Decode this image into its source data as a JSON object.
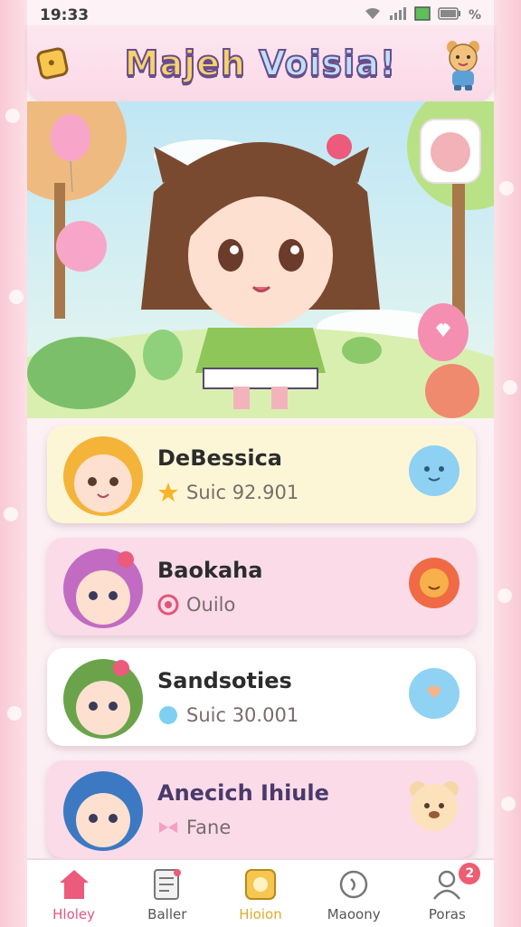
{
  "status_bar": {
    "time": "19:33",
    "battery_label": "%"
  },
  "header": {
    "title_part1": "Majeh",
    "title_part2": "Voisia!"
  },
  "cards": [
    {
      "name": "DeBessica",
      "stat": "Suic 92.901",
      "stat_icon": "star-icon",
      "bg": "#fdf6d6",
      "side_icon": "blue-cloud-icon"
    },
    {
      "name": "Baokaha",
      "stat": "Ouilo",
      "stat_icon": "pink-ring-icon",
      "bg": "#fbdbe8",
      "side_icon": "flower-icon"
    },
    {
      "name": "Sandsoties",
      "stat": "Suic 30.001",
      "stat_icon": "blue-orb-icon",
      "bg": "#ffffff",
      "side_icon": "heart-balloon-icon"
    },
    {
      "name": "Anecich Ihiule",
      "stat": "Fane",
      "stat_icon": "pink-bow-icon",
      "bg": "#fbdbe8",
      "side_icon": "bear-face-icon"
    }
  ],
  "nav": {
    "items": [
      {
        "label": "Hloley",
        "icon": "home-icon"
      },
      {
        "label": "Baller",
        "icon": "list-icon"
      },
      {
        "label": "Hioion",
        "icon": "gold-card-icon"
      },
      {
        "label": "Maoony",
        "icon": "search-icon"
      },
      {
        "label": "Poras",
        "icon": "profile-icon",
        "badge": "2"
      }
    ]
  },
  "colors": {
    "accent_pink": "#e3557e",
    "header_bg": "#fbd9e6",
    "badge_red": "#ee5d72"
  }
}
